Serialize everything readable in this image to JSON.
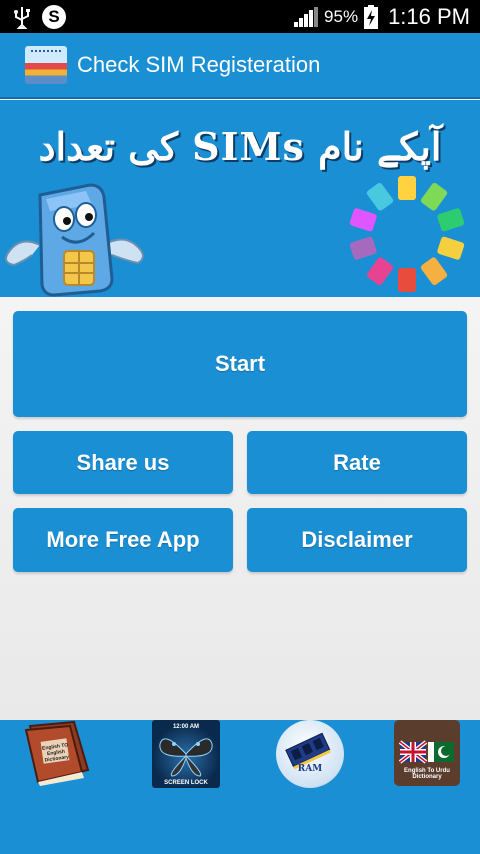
{
  "status_bar": {
    "battery_percent": "95%",
    "time": "1:16 PM",
    "icons": [
      "usb-icon",
      "skype-icon",
      "signal-icon",
      "battery-icon"
    ]
  },
  "app_bar": {
    "title": "Check SIM Registeration"
  },
  "banner": {
    "title": "آپکے نام SIMs کی تعداد"
  },
  "buttons": {
    "start": "Start",
    "share": "Share us",
    "rate": "Rate",
    "more": "More Free App",
    "disclaimer": "Disclaimer"
  },
  "ads": {
    "dictionary": "English TO English Dictionary",
    "screen_lock_time": "12:00 AM",
    "screen_lock_label": "SCREEN LOCK",
    "ram_label": "RAM",
    "urdu_dictionary": "English To Urdu Dictionary"
  },
  "colors": {
    "accent": "#1a8fd4",
    "status_bar": "#000000",
    "background": "#f2f2f2"
  }
}
